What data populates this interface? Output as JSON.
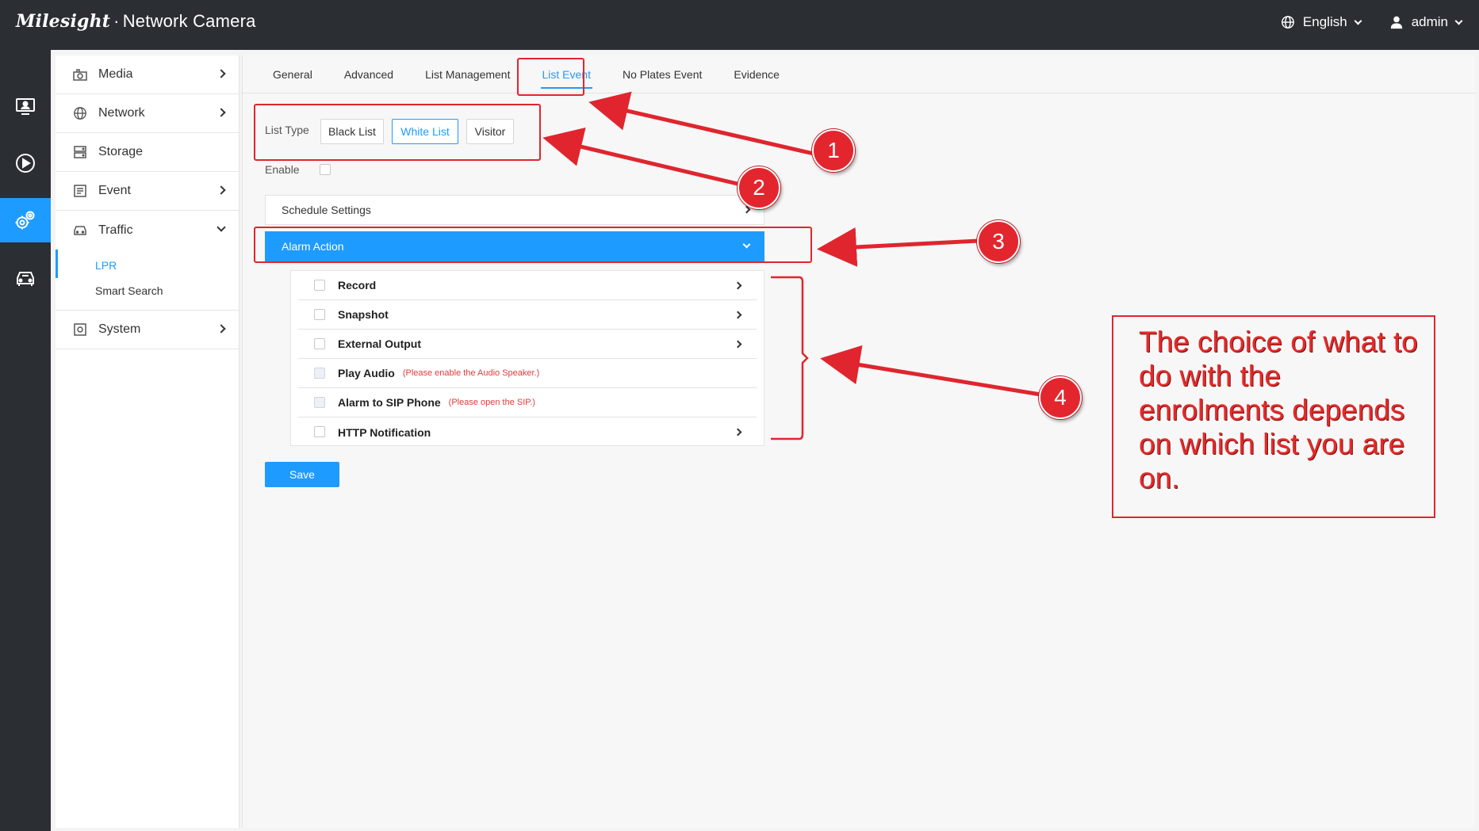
{
  "app": {
    "brand_logo": "Milesight",
    "brand_product": "Network Camera",
    "language": "English",
    "user": "admin"
  },
  "rail": [
    {
      "icon": "live-view-icon",
      "active": false
    },
    {
      "icon": "playback-icon",
      "active": false
    },
    {
      "icon": "settings-icon",
      "active": true
    },
    {
      "icon": "vehicle-icon",
      "active": false
    }
  ],
  "sidemenu": {
    "media": "Media",
    "network": "Network",
    "storage": "Storage",
    "event": "Event",
    "traffic": "Traffic",
    "traffic_sub": [
      "LPR",
      "Smart Search"
    ],
    "system": "System"
  },
  "tabs": [
    "General",
    "Advanced",
    "List Management",
    "List Event",
    "No Plates Event",
    "Evidence"
  ],
  "active_tab": "List Event",
  "list_type": {
    "label": "List Type",
    "options": [
      "Black List",
      "White List",
      "Visitor"
    ],
    "selected": "White List"
  },
  "enable_label": "Enable",
  "schedule_settings": "Schedule Settings",
  "alarm_action": "Alarm Action",
  "actions": [
    {
      "label": "Record",
      "note": "",
      "disabled": false,
      "arrow": true
    },
    {
      "label": "Snapshot",
      "note": "",
      "disabled": false,
      "arrow": true
    },
    {
      "label": "External Output",
      "note": "",
      "disabled": false,
      "arrow": true
    },
    {
      "label": "Play Audio",
      "note": "(Please enable the Audio Speaker.)",
      "disabled": true,
      "arrow": false
    },
    {
      "label": "Alarm to SIP Phone",
      "note": "(Please open the SIP.)",
      "disabled": true,
      "arrow": false
    },
    {
      "label": "HTTP Notification",
      "note": "",
      "disabled": false,
      "arrow": true
    }
  ],
  "save_label": "Save",
  "annotations": {
    "markers": [
      "1",
      "2",
      "3",
      "4"
    ],
    "note": "The choice of what to do with the enrolments depends on which list you are on.",
    "color": "#e0252e"
  },
  "colors": {
    "accent": "#1e9bff",
    "topbar": "#2b2e33",
    "warning": "#e23b3b"
  }
}
